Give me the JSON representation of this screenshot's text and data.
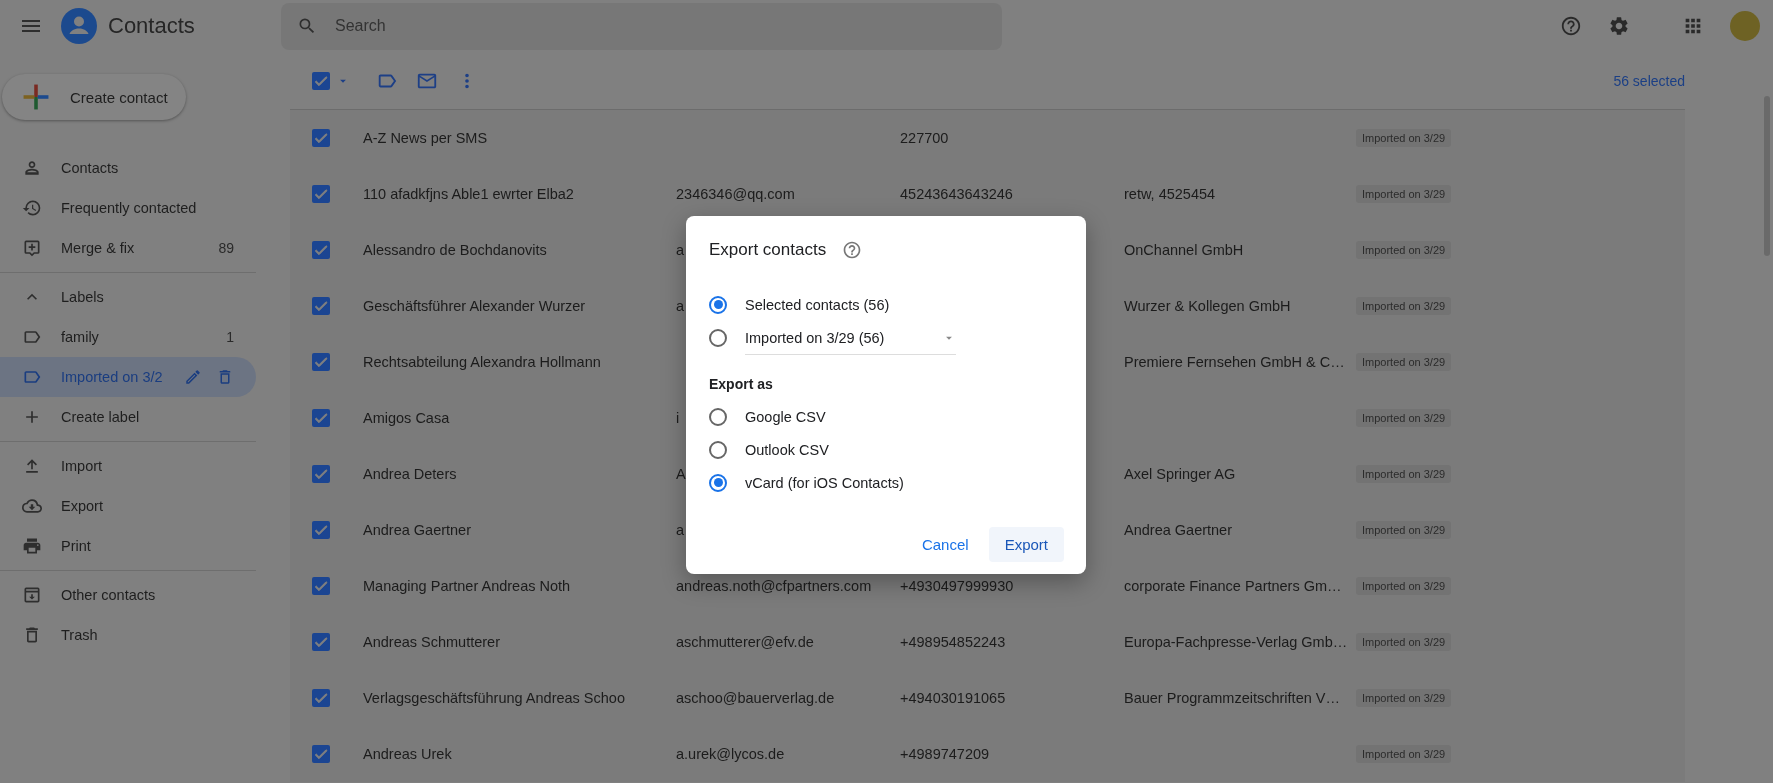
{
  "header": {
    "app_title": "Contacts",
    "search": {
      "placeholder": "Search"
    }
  },
  "sidebar": {
    "create_button": "Create contact",
    "groups": [
      {
        "items": [
          {
            "kind": "person",
            "label": "Contacts",
            "selected": false
          },
          {
            "kind": "history",
            "label": "Frequently contacted",
            "selected": false
          },
          {
            "kind": "merge",
            "label": "Merge & fix",
            "count": "89",
            "selected": false
          }
        ]
      },
      {
        "items": [
          {
            "kind": "toggle",
            "label": "Labels",
            "expanded": true
          },
          {
            "kind": "label",
            "label": "family",
            "count": "1",
            "selected": false
          },
          {
            "kind": "label",
            "label": "Imported on 3/2",
            "selected": true
          },
          {
            "kind": "add",
            "label": "Create label",
            "selected": false
          }
        ]
      },
      {
        "items": [
          {
            "kind": "import",
            "label": "Import",
            "selected": false
          },
          {
            "kind": "export",
            "label": "Export",
            "selected": false
          },
          {
            "kind": "print",
            "label": "Print",
            "selected": false
          }
        ]
      },
      {
        "items": [
          {
            "kind": "other",
            "label": "Other contacts",
            "selected": false
          },
          {
            "kind": "trash",
            "label": "Trash",
            "selected": false
          }
        ]
      }
    ]
  },
  "toolbar": {
    "select_all_checked": true,
    "selection_count": "56 selected"
  },
  "table": {
    "rows": [
      {
        "checked": true,
        "name": "A-Z News per SMS",
        "phone": "227700",
        "label": "Imported on 3/29"
      },
      {
        "checked": true,
        "name": "110 afadkfjns Able1 ewrter Elba2",
        "email": "2346346@qq.com",
        "phone": "45243643643246",
        "organization": "retw, 4525454",
        "label": "Imported on 3/29"
      },
      {
        "checked": true,
        "name": "Alessandro de Bochdanovits",
        "email": "a",
        "organization": "OnChannel GmbH",
        "label": "Imported on 3/29"
      },
      {
        "checked": true,
        "name": "Geschäftsführer Alexander Wurzer",
        "email": "a",
        "organization": "Wurzer & Kollegen GmbH",
        "label": "Imported on 3/29"
      },
      {
        "checked": true,
        "name": "Rechtsabteilung Alexandra Hollmann",
        "organization": "Premiere Fernsehen GmbH & C…",
        "label": "Imported on 3/29"
      },
      {
        "checked": true,
        "name": "Amigos Casa",
        "email": "i",
        "label": "Imported on 3/29"
      },
      {
        "checked": true,
        "name": "Andrea Deters",
        "email": "A",
        "organization": "Axel Springer AG",
        "label": "Imported on 3/29"
      },
      {
        "checked": true,
        "name": "Andrea Gaertner",
        "email": "a",
        "organization": "Andrea Gaertner",
        "label": "Imported on 3/29"
      },
      {
        "checked": true,
        "name": "Managing Partner Andreas Noth",
        "email": "andreas.noth@cfpartners.com",
        "phone": "+4930497999930",
        "organization": "corporate Finance Partners Gm…",
        "label": "Imported on 3/29"
      },
      {
        "checked": true,
        "name": "Andreas Schmutterer",
        "email": "aschmutterer@efv.de",
        "phone": "+498954852243",
        "organization": "Europa-Fachpresse-Verlag Gmb…",
        "label": "Imported on 3/29"
      },
      {
        "checked": true,
        "name": "Verlagsgeschäftsführung Andreas Schoo",
        "email": "aschoo@bauerverlag.de",
        "phone": "+494030191065",
        "organization": "Bauer Programmzeitschriften V…",
        "label": "Imported on 3/29"
      },
      {
        "checked": true,
        "name": "Andreas Urek",
        "email": "a.urek@lycos.de",
        "phone": "+4989747209",
        "label": "Imported on 3/29"
      }
    ]
  },
  "dialog": {
    "title": "Export contacts",
    "scope_options": [
      {
        "kind": "plain",
        "label": "Selected contacts (56)",
        "selected": true
      },
      {
        "kind": "dropdown",
        "label": "Imported on 3/29 (56)",
        "selected": false
      }
    ],
    "format_heading": "Export as",
    "format_options": [
      {
        "label": "Google CSV",
        "selected": false
      },
      {
        "label": "Outlook CSV",
        "selected": false
      },
      {
        "label": "vCard (for iOS Contacts)",
        "selected": true
      }
    ],
    "buttons": [
      {
        "kind": "text",
        "label": "Cancel"
      },
      {
        "kind": "tonal",
        "label": "Export"
      }
    ]
  }
}
